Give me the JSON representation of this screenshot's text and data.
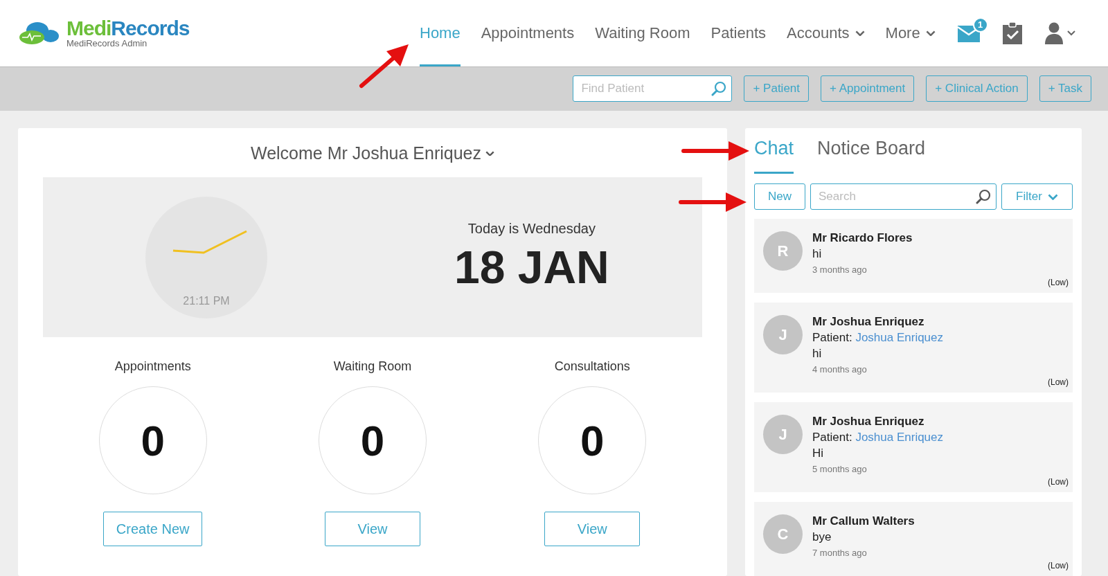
{
  "logo": {
    "first": "Medi",
    "second": "Records",
    "subtitle": "MediRecords Admin"
  },
  "nav": [
    {
      "label": "Home",
      "selected": true,
      "dropdown": false
    },
    {
      "label": "Appointments",
      "selected": false,
      "dropdown": false
    },
    {
      "label": "Waiting Room",
      "selected": false,
      "dropdown": false
    },
    {
      "label": "Patients",
      "selected": false,
      "dropdown": false
    },
    {
      "label": "Accounts",
      "selected": false,
      "dropdown": true
    },
    {
      "label": "More",
      "selected": false,
      "dropdown": true
    }
  ],
  "mail_badge": "1",
  "toolbar": {
    "find_placeholder": "Find Patient",
    "buttons": [
      "+ Patient",
      "+ Appointment",
      "+ Clinical Action",
      "+ Task"
    ]
  },
  "welcome": {
    "title": "Welcome Mr Joshua Enriquez",
    "clock_time": "21:11 PM",
    "day": "Today is Wednesday",
    "date": "18 JAN"
  },
  "stats": [
    {
      "label": "Appointments",
      "value": "0",
      "button": "Create New"
    },
    {
      "label": "Waiting Room",
      "value": "0",
      "button": "View"
    },
    {
      "label": "Consultations",
      "value": "0",
      "button": "View"
    }
  ],
  "side_tabs": [
    {
      "label": "Chat",
      "selected": true
    },
    {
      "label": "Notice Board",
      "selected": false
    }
  ],
  "chat_toolbar": {
    "new": "New",
    "search_placeholder": "Search",
    "filter": "Filter"
  },
  "messages": [
    {
      "initial": "R",
      "name": "Mr Ricardo Flores",
      "text": "hi",
      "time": "3 months ago",
      "priority": "(Low)"
    },
    {
      "initial": "J",
      "name": "Mr Joshua Enriquez",
      "patient_label": "Patient:",
      "patient": "Joshua Enriquez",
      "text": "hi",
      "time": "4 months ago",
      "priority": "(Low)"
    },
    {
      "initial": "J",
      "name": "Mr Joshua Enriquez",
      "patient_label": "Patient:",
      "patient": "Joshua Enriquez",
      "text": "Hi",
      "time": "5 months ago",
      "priority": "(Low)"
    },
    {
      "initial": "C",
      "name": "Mr Callum Walters",
      "text": "bye",
      "time": "7 months ago",
      "priority": "(Low)"
    }
  ]
}
